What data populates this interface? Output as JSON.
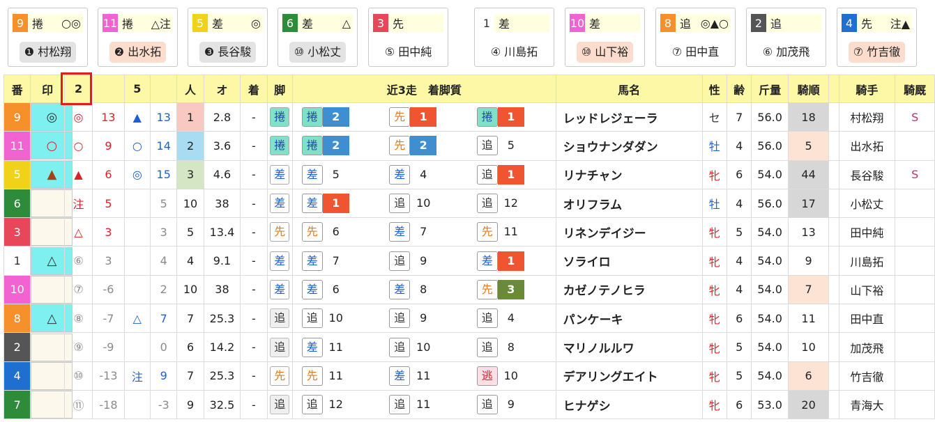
{
  "cards": [
    {
      "num": "9",
      "num_color": "#f5902a",
      "pos": "捲",
      "marks": "○◎",
      "jockey": "❶ 村松翔",
      "jstyle": "jg"
    },
    {
      "num": "11",
      "num_color": "#f063d0",
      "pos": "捲",
      "marks": "△注",
      "jockey": "❷ 出水拓",
      "jstyle": "jo"
    },
    {
      "num": "5",
      "num_color": "#f0d21a",
      "pos": "差",
      "marks": "◎",
      "jockey": "❸ 長谷駿",
      "jstyle": "jg"
    },
    {
      "num": "6",
      "num_color": "#2e8b3a",
      "pos": "差",
      "marks": "△",
      "jockey": "⑩ 小松丈",
      "jstyle": "jg"
    },
    {
      "num": "3",
      "num_color": "#e8475a",
      "pos": "先",
      "marks": "",
      "jockey": "⑤ 田中純",
      "jstyle": "jn"
    },
    {
      "num": "1",
      "num_color": "#ffffff",
      "pos": "差",
      "marks": "",
      "jockey": "④ 川島拓",
      "jstyle": "jn"
    },
    {
      "num": "10",
      "num_color": "#f063d0",
      "pos": "差",
      "marks": "",
      "jockey": "⑩ 山下裕",
      "jstyle": "jo"
    },
    {
      "num": "8",
      "num_color": "#f5902a",
      "pos": "追",
      "marks": "◎▲○",
      "jockey": "⑦ 田中直",
      "jstyle": "jn"
    },
    {
      "num": "2",
      "num_color": "#555555",
      "pos": "追",
      "marks": "",
      "jockey": "⑥ 加茂飛",
      "jstyle": "jn"
    },
    {
      "num": "4",
      "num_color": "#1f6fd0",
      "pos": "先",
      "marks": "注▲",
      "jockey": "⑦ 竹吉徹",
      "jstyle": "jo"
    }
  ],
  "headers": [
    "番",
    "印",
    "2",
    "",
    "5",
    "",
    "人",
    "オ",
    "着",
    "脚",
    "近3走　着脚質",
    "馬名",
    "性",
    "齢",
    "斤量",
    "騎順",
    "",
    "騎手",
    "騎厩"
  ],
  "rows": [
    {
      "no": "9",
      "no_color": "#f5902a",
      "mark": "◎",
      "mark_bg": "mk-cyan",
      "mark_color": "dark",
      "m2": "◎",
      "m2c": "red",
      "v2": "13",
      "v2c": "red",
      "m5": "▲",
      "m5c": "blue",
      "v5": "13",
      "v5c": "blue",
      "pop": "1",
      "popbg": "popbg-pink",
      "odds": "2.8",
      "chaku": "-",
      "kyaku": "捲",
      "kcls": "k-makuri",
      "recent": [
        {
          "b": "捲",
          "bc": "b-makuri",
          "r": "2",
          "rc": "r-blue"
        },
        {
          "b": "先",
          "bc": "b-sen",
          "r": "1",
          "rc": "r-red"
        },
        {
          "b": "捲",
          "bc": "b-makuri",
          "r": "1",
          "rc": "r-red"
        }
      ],
      "horse": "レッドレジェーラ",
      "sex": "セ",
      "sexc": "sex-g",
      "age": "7",
      "kin": "56.0",
      "jun": "18",
      "junc": "jun-gray",
      "jockey": "村松翔",
      "kyu": "S"
    },
    {
      "no": "11",
      "no_color": "#f063d0",
      "mark": "○",
      "mark_bg": "mk-cyan",
      "mark_color": "red",
      "m2": "○",
      "m2c": "red",
      "v2": "9",
      "v2c": "red",
      "m5": "○",
      "m5c": "blue",
      "v5": "14",
      "v5c": "blue",
      "pop": "2",
      "popbg": "popbg-blue",
      "odds": "3.6",
      "chaku": "-",
      "kyaku": "捲",
      "kcls": "k-makuri",
      "recent": [
        {
          "b": "捲",
          "bc": "b-makuri",
          "r": "2",
          "rc": "r-blue"
        },
        {
          "b": "先",
          "bc": "b-sen",
          "r": "2",
          "rc": "r-blue"
        },
        {
          "b": "追",
          "bc": "b-oi",
          "r": "5",
          "rc": ""
        }
      ],
      "horse": "ショウナンダダン",
      "sex": "牡",
      "sexc": "sex-s",
      "age": "4",
      "kin": "56.0",
      "jun": "5",
      "junc": "jun-orange",
      "jockey": "出水拓",
      "kyu": ""
    },
    {
      "no": "5",
      "no_color": "#f0d21a",
      "mark": "▲",
      "mark_bg": "mk-cyan",
      "mark_color": "brown",
      "m2": "▲",
      "m2c": "red",
      "v2": "6",
      "v2c": "red",
      "m5": "◎",
      "m5c": "blue",
      "v5": "15",
      "v5c": "blue",
      "pop": "3",
      "popbg": "popbg-green",
      "odds": "4.6",
      "chaku": "-",
      "kyaku": "差",
      "kcls": "k-sashi",
      "recent": [
        {
          "b": "差",
          "bc": "b-sashi",
          "r": "5",
          "rc": ""
        },
        {
          "b": "差",
          "bc": "b-sashi",
          "r": "4",
          "rc": ""
        },
        {
          "b": "追",
          "bc": "b-oi",
          "r": "1",
          "rc": "r-red"
        }
      ],
      "horse": "リナチャン",
      "sex": "牝",
      "sexc": "sex-h",
      "age": "6",
      "kin": "54.0",
      "jun": "44",
      "junc": "jun-gray",
      "jockey": "長谷駿",
      "kyu": "S"
    },
    {
      "no": "6",
      "no_color": "#2e8b3a",
      "mark": "",
      "mark_bg": "mk-cream",
      "mark_color": "dark",
      "m2": "注",
      "m2c": "red",
      "v2": "5",
      "v2c": "red",
      "m5": "",
      "m5c": "blue",
      "v5": "5",
      "v5c": "gray",
      "pop": "10",
      "popbg": "",
      "odds": "38",
      "chaku": "-",
      "kyaku": "差",
      "kcls": "k-sashi",
      "recent": [
        {
          "b": "差",
          "bc": "b-sashi",
          "r": "1",
          "rc": "r-red"
        },
        {
          "b": "追",
          "bc": "b-oi",
          "r": "10",
          "rc": ""
        },
        {
          "b": "追",
          "bc": "b-oi",
          "r": "12",
          "rc": ""
        }
      ],
      "horse": "オリフラム",
      "sex": "牡",
      "sexc": "sex-s",
      "age": "4",
      "kin": "56.0",
      "jun": "17",
      "junc": "jun-gray",
      "jockey": "小松丈",
      "kyu": ""
    },
    {
      "no": "3",
      "no_color": "#e8475a",
      "mark": "",
      "mark_bg": "mk-cream",
      "mark_color": "dark",
      "m2": "△",
      "m2c": "red",
      "v2": "3",
      "v2c": "red",
      "m5": "",
      "m5c": "blue",
      "v5": "3",
      "v5c": "gray",
      "pop": "5",
      "popbg": "",
      "odds": "13.4",
      "chaku": "-",
      "kyaku": "先",
      "kcls": "k-sen",
      "recent": [
        {
          "b": "先",
          "bc": "b-sen",
          "r": "6",
          "rc": ""
        },
        {
          "b": "差",
          "bc": "b-sashi",
          "r": "7",
          "rc": ""
        },
        {
          "b": "先",
          "bc": "b-sen",
          "r": "11",
          "rc": ""
        }
      ],
      "horse": "リネンデイジー",
      "sex": "牝",
      "sexc": "sex-h",
      "age": "5",
      "kin": "54.0",
      "jun": "13",
      "junc": "",
      "jockey": "田中純",
      "kyu": ""
    },
    {
      "no": "1",
      "no_color": "#ffffff",
      "mark": "△",
      "mark_bg": "mk-cyan",
      "mark_color": "dark",
      "m2": "⑥",
      "m2c": "gray",
      "v2": "3",
      "v2c": "gray",
      "m5": "",
      "m5c": "blue",
      "v5": "4",
      "v5c": "gray",
      "pop": "4",
      "popbg": "",
      "odds": "9.1",
      "chaku": "-",
      "kyaku": "差",
      "kcls": "k-sashi",
      "recent": [
        {
          "b": "差",
          "bc": "b-sashi",
          "r": "7",
          "rc": ""
        },
        {
          "b": "追",
          "bc": "b-oi",
          "r": "9",
          "rc": ""
        },
        {
          "b": "差",
          "bc": "b-sashi",
          "r": "1",
          "rc": "r-red"
        }
      ],
      "horse": "ソライロ",
      "sex": "牝",
      "sexc": "sex-h",
      "age": "4",
      "kin": "54.0",
      "jun": "9",
      "junc": "",
      "jockey": "川島拓",
      "kyu": ""
    },
    {
      "no": "10",
      "no_color": "#f063d0",
      "mark": "",
      "mark_bg": "mk-cream",
      "mark_color": "dark",
      "m2": "⑦",
      "m2c": "gray",
      "v2": "-6",
      "v2c": "gray",
      "m5": "",
      "m5c": "blue",
      "v5": "2",
      "v5c": "gray",
      "pop": "10",
      "popbg": "",
      "odds": "38",
      "chaku": "-",
      "kyaku": "差",
      "kcls": "k-sashi",
      "recent": [
        {
          "b": "差",
          "bc": "b-sashi",
          "r": "6",
          "rc": ""
        },
        {
          "b": "差",
          "bc": "b-sashi",
          "r": "8",
          "rc": ""
        },
        {
          "b": "先",
          "bc": "b-sen",
          "r": "3",
          "rc": "r-green"
        }
      ],
      "horse": "カゼノテノヒラ",
      "sex": "牝",
      "sexc": "sex-h",
      "age": "4",
      "kin": "54.0",
      "jun": "7",
      "junc": "jun-orange",
      "jockey": "山下裕",
      "kyu": ""
    },
    {
      "no": "8",
      "no_color": "#f5902a",
      "mark": "△",
      "mark_bg": "mk-cyan",
      "mark_color": "dark",
      "m2": "⑧",
      "m2c": "gray",
      "v2": "-7",
      "v2c": "gray",
      "m5": "△",
      "m5c": "blue",
      "v5": "7",
      "v5c": "blue",
      "pop": "7",
      "popbg": "",
      "odds": "25.3",
      "chaku": "-",
      "kyaku": "追",
      "kcls": "k-oi-g",
      "recent": [
        {
          "b": "追",
          "bc": "b-oi",
          "r": "10",
          "rc": ""
        },
        {
          "b": "追",
          "bc": "b-oi",
          "r": "9",
          "rc": ""
        },
        {
          "b": "追",
          "bc": "b-oi",
          "r": "4",
          "rc": ""
        }
      ],
      "horse": "パンケーキ",
      "sex": "牝",
      "sexc": "sex-h",
      "age": "6",
      "kin": "54.0",
      "jun": "11",
      "junc": "",
      "jockey": "田中直",
      "kyu": ""
    },
    {
      "no": "2",
      "no_color": "#555555",
      "mark": "",
      "mark_bg": "mk-cream",
      "mark_color": "dark",
      "m2": "⑨",
      "m2c": "gray",
      "v2": "-9",
      "v2c": "gray",
      "m5": "",
      "m5c": "blue",
      "v5": "0",
      "v5c": "gray",
      "pop": "6",
      "popbg": "",
      "odds": "14.2",
      "chaku": "-",
      "kyaku": "追",
      "kcls": "k-oi-g",
      "recent": [
        {
          "b": "差",
          "bc": "b-sashi",
          "r": "11",
          "rc": ""
        },
        {
          "b": "追",
          "bc": "b-oi",
          "r": "10",
          "rc": ""
        },
        {
          "b": "追",
          "bc": "b-oi",
          "r": "8",
          "rc": ""
        }
      ],
      "horse": "マリノルルワ",
      "sex": "牝",
      "sexc": "sex-h",
      "age": "5",
      "kin": "54.0",
      "jun": "10",
      "junc": "",
      "jockey": "加茂飛",
      "kyu": ""
    },
    {
      "no": "4",
      "no_color": "#1f6fd0",
      "mark": "",
      "mark_bg": "mk-cream",
      "mark_color": "dark",
      "m2": "⑩",
      "m2c": "gray",
      "v2": "-13",
      "v2c": "gray",
      "m5": "注",
      "m5c": "blue",
      "v5": "9",
      "v5c": "blue",
      "pop": "7",
      "popbg": "",
      "odds": "25.3",
      "chaku": "-",
      "kyaku": "先",
      "kcls": "k-sen",
      "recent": [
        {
          "b": "先",
          "bc": "b-sen",
          "r": "11",
          "rc": ""
        },
        {
          "b": "差",
          "bc": "b-sashi",
          "r": "11",
          "rc": ""
        },
        {
          "b": "逃",
          "bc": "b-nige",
          "r": "10",
          "rc": ""
        }
      ],
      "horse": "デアリングエイト",
      "sex": "牝",
      "sexc": "sex-h",
      "age": "5",
      "kin": "54.0",
      "jun": "6",
      "junc": "jun-orange",
      "jockey": "竹吉徹",
      "kyu": ""
    },
    {
      "no": "7",
      "no_color": "#2e8b3a",
      "mark": "",
      "mark_bg": "mk-cream",
      "mark_color": "dark",
      "m2": "⑪",
      "m2c": "gray",
      "v2": "-18",
      "v2c": "gray",
      "m5": "",
      "m5c": "blue",
      "v5": "-3",
      "v5c": "gray",
      "pop": "9",
      "popbg": "",
      "odds": "32.5",
      "chaku": "-",
      "kyaku": "追",
      "kcls": "k-oi-g",
      "recent": [
        {
          "b": "追",
          "bc": "b-oi",
          "r": "12",
          "rc": ""
        },
        {
          "b": "追",
          "bc": "b-oi",
          "r": "11",
          "rc": ""
        },
        {
          "b": "追",
          "bc": "b-oi",
          "r": "9",
          "rc": ""
        }
      ],
      "horse": "ヒナゲシ",
      "sex": "牝",
      "sexc": "sex-h",
      "age": "6",
      "kin": "53.0",
      "jun": "20",
      "junc": "jun-gray",
      "jockey": "青海大",
      "kyu": ""
    }
  ]
}
